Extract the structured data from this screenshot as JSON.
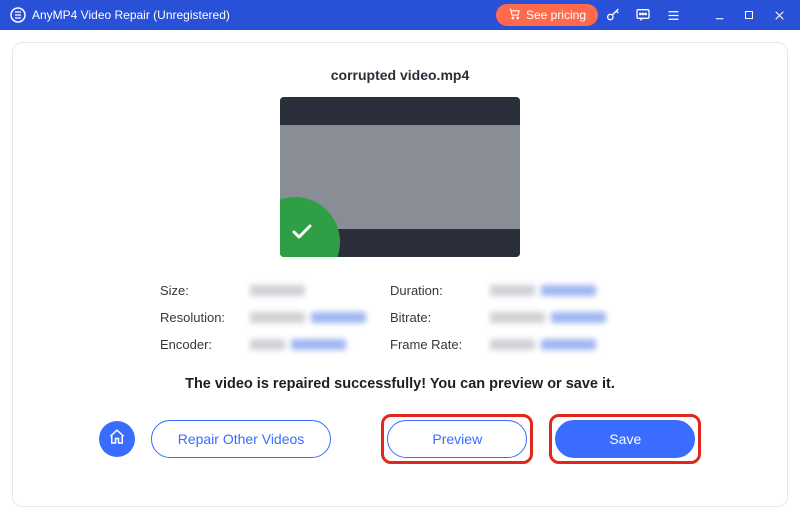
{
  "titlebar": {
    "app_title": "AnyMP4 Video Repair (Unregistered)",
    "see_pricing_label": "See pricing"
  },
  "main": {
    "filename": "corrupted video.mp4",
    "details": {
      "size_label": "Size:",
      "duration_label": "Duration:",
      "resolution_label": "Resolution:",
      "bitrate_label": "Bitrate:",
      "encoder_label": "Encoder:",
      "frame_rate_label": "Frame Rate:"
    },
    "message": "The video is repaired successfully! You can preview or save it.",
    "buttons": {
      "repair_other": "Repair Other Videos",
      "preview": "Preview",
      "save": "Save"
    }
  }
}
